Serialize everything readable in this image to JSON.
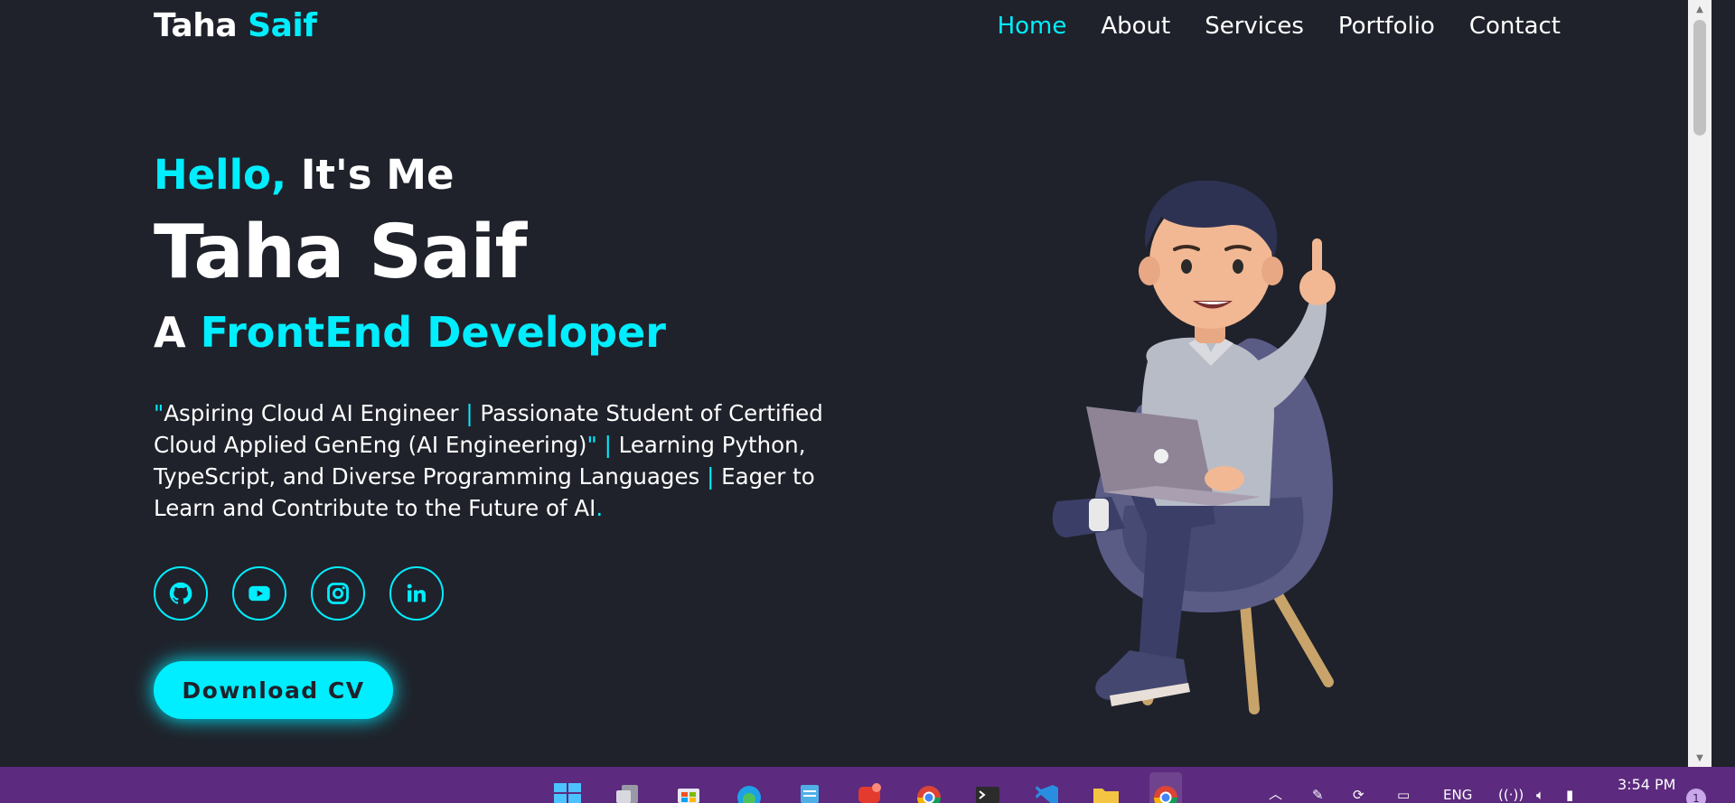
{
  "nav": {
    "logo_first": "Taha ",
    "logo_accent": "Saif",
    "links": [
      "Home",
      "About",
      "Services",
      "Portfolio",
      "Contact"
    ],
    "active": "Home"
  },
  "hero": {
    "greeting_accent": "Hello,",
    "greeting_rest": " It's Me",
    "name": "Taha Saif",
    "role_prefix": "A ",
    "role_accent": "FrontEnd Developer",
    "bio": {
      "q_open": "\"",
      "p1": "Aspiring Cloud AI Engineer ",
      "s1": "|",
      "p2": " Passionate Student of Certified Cloud Applied GenEng (AI Engineering)",
      "q_close": "\"",
      "s2": " |",
      "p3": " Learning Python, TypeScript, and Diverse Programming Languages ",
      "s3": "|",
      "p4": " Eager to Learn and Contribute to the Future of AI",
      "dot": "."
    },
    "socials": [
      "github-icon",
      "youtube-icon",
      "instagram-icon",
      "linkedin-icon"
    ],
    "cta": "Download CV"
  },
  "taskbar": {
    "language": "ENG",
    "time": "3:54 PM",
    "notifications": "1",
    "apps": [
      "windows-start-icon",
      "task-view-icon",
      "microsoft-store-icon",
      "edge-icon",
      "notepad-icon",
      "wps-office-icon",
      "chrome-icon",
      "terminal-icon",
      "vscode-icon",
      "file-explorer-icon",
      "chrome-icon"
    ]
  },
  "colors": {
    "accent": "#00eeff",
    "background": "#1f222b",
    "taskbar": "#5c2a7e"
  }
}
